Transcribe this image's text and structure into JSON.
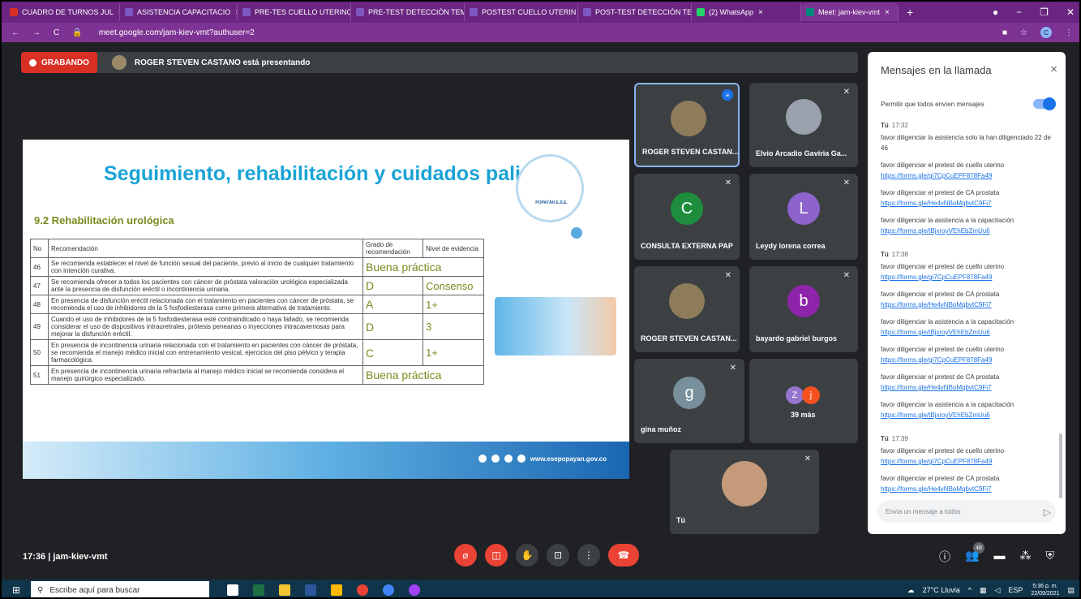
{
  "browser": {
    "tabs": [
      {
        "label": "CUADRO DE TURNOS JUL",
        "color": "#d93025"
      },
      {
        "label": "ASISTENCIA CAPACITACIO",
        "color": "#7e57c2"
      },
      {
        "label": "PRE-TES CUELLO UTERINO",
        "color": "#7e57c2"
      },
      {
        "label": "PRE-TEST DETECCIÓN TEM",
        "color": "#7e57c2"
      },
      {
        "label": "POSTEST CUELLO UTERIN",
        "color": "#7e57c2"
      },
      {
        "label": "POST-TEST DETECCIÓN TE",
        "color": "#7e57c2"
      },
      {
        "label": "(2) WhatsApp",
        "color": "#25d366"
      },
      {
        "label": "Meet: jam-kiev-vmt",
        "color": "#00897b"
      }
    ],
    "close_glyph": "×",
    "new_tab_glyph": "+",
    "url": "meet.google.com/jam-kiev-vmt?authuser=2",
    "profile_letter": "C"
  },
  "recording": {
    "badge": "GRABANDO",
    "presenting_text": "ROGER STEVEN CASTANO está presentando"
  },
  "slide": {
    "title": "Seguimiento, rehabilitación y cuidados paliativos",
    "subtitle": "9.2 Rehabilitación urológica",
    "logo_text": "POPAYÁN E.S.E.",
    "table_headers": {
      "no": "No",
      "rec": "Recomendación",
      "grade": "Grado de recomendación",
      "level": "Nivel de evidencia"
    },
    "rows": [
      {
        "no": "46",
        "rec": "Se recomienda establecer el nivel de función sexual del paciente, previo al inicio de cualquier tratamiento con intención curativa.",
        "grade": "Buena práctica",
        "level": ""
      },
      {
        "no": "47",
        "rec": "Se recomienda ofrecer a todos los pacientes con cáncer de próstata valoración urológica especializada ante la presencia de disfunción eréctil o incontinencia urinaria.",
        "grade": "D",
        "level": "Consenso"
      },
      {
        "no": "48",
        "rec": "En presencia de disfunción eréctil relacionada con el tratamiento en pacientes con cáncer de próstata, se recomienda el uso de inhibidores de la 5 fosfodiesterasa como primera alternativa de tratamiento.",
        "grade": "A",
        "level": "1+"
      },
      {
        "no": "49",
        "rec": "Cuando el uso de inhibidores de la 5 fosfodiesterasa esté contraindicado o haya fallado, se recomienda considerar el uso de dispositivos intrauretrales, prótesis peneanas o inyecciones intracavernosas para mejorar la disfunción eréctil.",
        "grade": "D",
        "level": "3"
      },
      {
        "no": "50",
        "rec": "En presencia de incontinencia urinaria relacionada con el tratamiento en pacientes con cáncer de próstata, se recomienda el manejo médico inicial con entrenamiento vesical, ejercicios del piso pélvico y terapia farmacológica.",
        "grade": "C",
        "level": "1+"
      },
      {
        "no": "51",
        "rec": "En presencia de incontinencia urinaria refractaria al manejo médico inicial se recomienda considera el manejo quirúrgico especializado.",
        "grade": "Buena práctica",
        "level": ""
      }
    ],
    "website": "www.esepopayan.gov.co"
  },
  "participants": [
    {
      "name": "ROGER STEVEN CASTAN...",
      "kind": "photo",
      "color": "#8d7b5a",
      "speaking": true
    },
    {
      "name": "Elvio Arcadio Gaviria Ga...",
      "kind": "photo",
      "color": "#9aa3ad",
      "speaking": false
    },
    {
      "name": "CONSULTA EXTERNA PAP",
      "kind": "letter",
      "letter": "C",
      "color": "#1e8e3e"
    },
    {
      "name": "Leydy lorena correa",
      "kind": "letter",
      "letter": "L",
      "color": "#8e63ce"
    },
    {
      "name": "ROGER STEVEN CASTAN...",
      "kind": "photo",
      "color": "#8d7b5a"
    },
    {
      "name": "bayardo gabriel burgos",
      "kind": "letter",
      "letter": "b",
      "color": "#8e24aa"
    },
    {
      "name": "gina muñoz",
      "kind": "letter",
      "letter": "g",
      "color": "#78909c"
    },
    {
      "name": "39 más",
      "kind": "more",
      "letters": [
        "Z",
        "j"
      ],
      "colors": [
        "#9575cd",
        "#f4511e"
      ]
    },
    {
      "name": "Tú",
      "kind": "photo",
      "color": "#c49a7a"
    }
  ],
  "chat": {
    "title": "Mensajes en la llamada",
    "allow_label": "Permitir que todos envíen mensajes",
    "allow_on": true,
    "groups": [
      {
        "sender": "Tú",
        "time": "17:32",
        "messages": [
          {
            "text": "favor diligenciar la asistencia solo la han diligenciado 22 de 46"
          },
          {
            "text": "favor diligenciar el pretest de cuello uterino",
            "link": "https://forms.gle/gi7CpCuEPF878Fa49"
          },
          {
            "text": "favor diligenciar el pretest de CA prostata",
            "link": "https://forms.gle/He4vNBoMqbvtC9Fi7"
          },
          {
            "text": "favor diligenciar la asistencia a la capacitación",
            "link": "https://forms.gle/tBjxroyVEhEbZmUu6"
          }
        ]
      },
      {
        "sender": "Tú",
        "time": "17:38",
        "messages": [
          {
            "text": "favor diligenciar el pretest de cuello uterino",
            "link": "https://forms.gle/gi7CpCuEPF878Fa49"
          },
          {
            "text": "favor diligenciar el pretest de CA prostata",
            "link": "https://forms.gle/He4vNBoMqbvtC9Fi7"
          },
          {
            "text": "favor diligenciar la asistencia a la capacitación",
            "link": "https://forms.gle/tBjxroyVEhEbZmUu6"
          },
          {
            "text": "favor diligenciar el pretest de cuello uterino",
            "link": "https://forms.gle/gi7CpCuEPF878Fa49"
          },
          {
            "text": "favor diligenciar el pretest de CA prostata",
            "link": "https://forms.gle/He4vNBoMqbvtC9Fi7"
          },
          {
            "text": "favor diligenciar la asistencia a la capacitación",
            "link": "https://forms.gle/tBjxroyVEhEbZmUu6"
          }
        ]
      },
      {
        "sender": "Tú",
        "time": "17:39",
        "messages": [
          {
            "text": "favor diligenciar el pretest de cuello uterino",
            "link": "https://forms.gle/gi7CpCuEPF878Fa49"
          },
          {
            "text": "favor diligenciar el pretest de CA prostata",
            "link": "https://forms.gle/He4vNBoMqbvtC9Fi7"
          },
          {
            "text": "favor diligenciar la asistencia a la capacitación",
            "link": "https://forms.gle/tBjxroyVEhEbZmUu6"
          }
        ]
      }
    ],
    "input_placeholder": "Envía un mensaje a todos",
    "close_glyph": "×",
    "send_glyph": "▷"
  },
  "meeting": {
    "time": "17:36",
    "code": "jam-kiev-vmt",
    "participants_count": "48"
  },
  "taskbar": {
    "search_placeholder": "Escribe aquí para buscar",
    "weather": "27°C Lluvia",
    "lang": "ESP",
    "time": "5:36 p. m.",
    "date": "22/09/2021"
  }
}
